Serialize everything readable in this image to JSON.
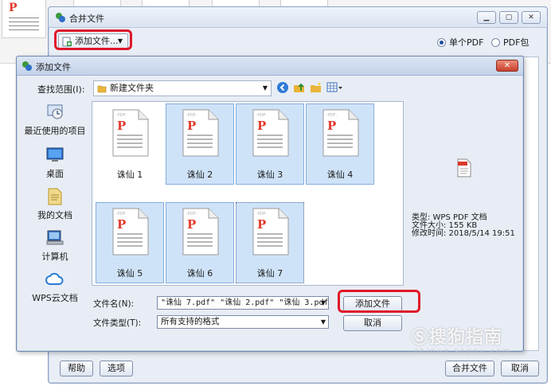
{
  "merge_window": {
    "title": "合并文件",
    "add_file_menu": "添加文件...",
    "mode_single_pdf": "单个PDF",
    "mode_pdf_package": "PDF包",
    "mode_selected": "single_pdf",
    "help_button": "帮助",
    "options_button": "选项",
    "merge_button": "合并文件",
    "cancel_button": "取消"
  },
  "dialog": {
    "title": "添加文件",
    "look_in_label": "查找范围(I):",
    "look_in_value": "新建文件夹",
    "places": [
      {
        "label": "最近使用的项目",
        "icon": "recent-items-icon"
      },
      {
        "label": "桌面",
        "icon": "desktop-icon"
      },
      {
        "label": "我的文档",
        "icon": "documents-icon"
      },
      {
        "label": "计算机",
        "icon": "computer-icon"
      },
      {
        "label": "WPS云文档",
        "icon": "cloud-icon"
      }
    ],
    "files": [
      {
        "name": "诛仙 1",
        "selected": false,
        "focused": false
      },
      {
        "name": "诛仙 2",
        "selected": true,
        "focused": false
      },
      {
        "name": "诛仙 3",
        "selected": true,
        "focused": false
      },
      {
        "name": "诛仙 4",
        "selected": true,
        "focused": false
      },
      {
        "name": "诛仙 5",
        "selected": true,
        "focused": false
      },
      {
        "name": "诛仙 6",
        "selected": true,
        "focused": false
      },
      {
        "name": "诛仙 7",
        "selected": true,
        "focused": true
      }
    ],
    "file_badge": "PDF",
    "preview": {
      "type": "类型: WPS PDF 文档",
      "size": "文件大小: 155 KB",
      "modified": "修改时间: 2018/5/14 19:51"
    },
    "filename_label": "文件名(N):",
    "filename_value": "\"诛仙 7.pdf\" \"诛仙 2.pdf\" \"诛仙 3.pdf\"",
    "filetype_label": "文件类型(T):",
    "filetype_value": "所有支持的格式",
    "add_button": "添加文件",
    "cancel_button": "取消"
  },
  "watermark": {
    "text": "搜狗指南",
    "sub": "zhinan.sogou.com"
  },
  "colors": {
    "highlight_ring": "#e0182a",
    "selection": "#cfe3f8",
    "pdf_red": "#e23a2c"
  }
}
